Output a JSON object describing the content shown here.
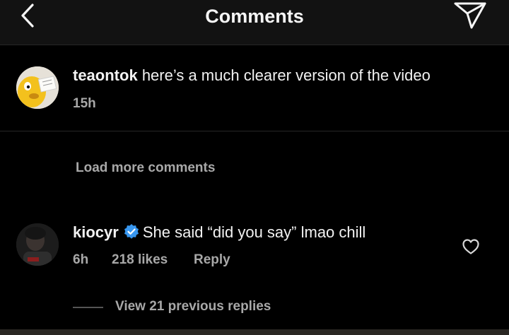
{
  "header": {
    "title": "Comments",
    "back_icon": "chevron-left-icon",
    "send_icon": "paper-plane-icon"
  },
  "caption": {
    "username": "teaontok",
    "text": "here’s a much clearer version of the video",
    "time": "15h"
  },
  "load_more": "Load more comments",
  "comment": {
    "username": "kiocyr",
    "verified_icon": "verified-badge-icon",
    "text": "She said “did you say” lmao chill",
    "time": "6h",
    "likes": "218 likes",
    "reply": "Reply",
    "like_icon": "heart-outline-icon"
  },
  "view_replies": "View 21 previous replies",
  "colors": {
    "background": "#000000",
    "header_bg": "#121212",
    "primary_text": "#f2f2f2",
    "secondary_text": "#a8a8a8",
    "verified": "#3897f0"
  }
}
